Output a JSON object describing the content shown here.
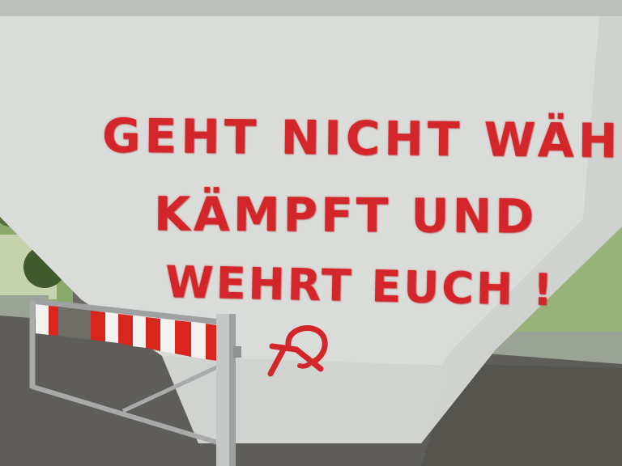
{
  "photo": {
    "subject": "graffiti",
    "colors": {
      "paint": "#d3262a",
      "pillar": "#d9dcd8",
      "ground": "#5e5d59",
      "barrier_stripe_red": "#d8261f",
      "barrier_stripe_white": "#f2f2f0",
      "vegetation": "#8aa86a"
    }
  },
  "graffiti": {
    "line1": "GEHT NICHT WÄHLEN !",
    "line2": "KÄMPFT UND",
    "line3": "WEHRT EUCH !",
    "symbol": "hammer-and-sickle-icon"
  }
}
